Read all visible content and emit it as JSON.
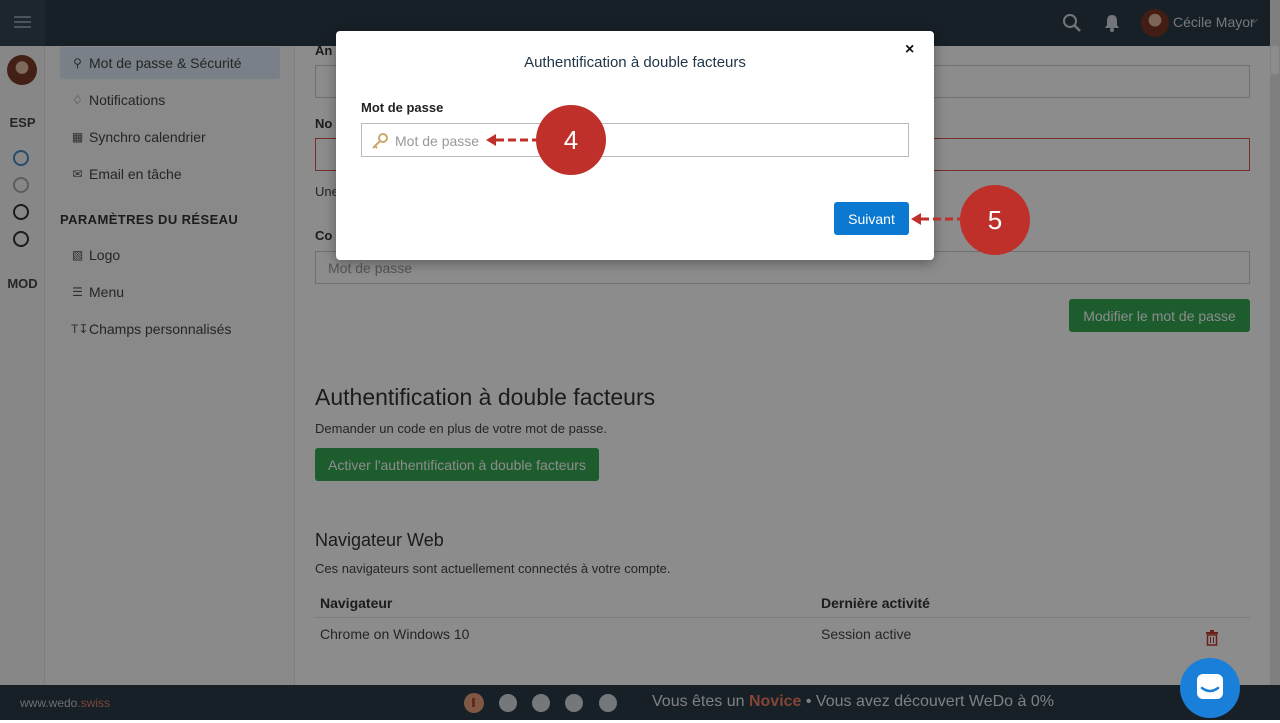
{
  "topbar": {
    "user_name": "Cécile Mayor",
    "icons": [
      "menu-icon",
      "search-icon",
      "bell-icon",
      "chevron-down-icon"
    ]
  },
  "rail": {
    "labels": [
      "ESP",
      "MOD"
    ]
  },
  "settings_nav": {
    "items": [
      {
        "label": "Mot de passe & Sécurité",
        "icon": "key-icon",
        "active": true
      },
      {
        "label": "Notifications",
        "icon": "bell-icon"
      },
      {
        "label": "Synchro calendrier",
        "icon": "calendar-icon"
      },
      {
        "label": "Email en tâche",
        "icon": "envelope-icon"
      }
    ],
    "section_title": "PARAMÈTRES DU RÉSEAU",
    "network_items": [
      {
        "label": "Logo",
        "icon": "building-icon"
      },
      {
        "label": "Menu",
        "icon": "bars-icon"
      },
      {
        "label": "Champs personnalisés",
        "icon": "text-icon"
      }
    ]
  },
  "main": {
    "fragments": {
      "old": "An",
      "new": "No",
      "hint": "Une",
      "confirm": "Co"
    },
    "password_placeholder": "Mot de passe",
    "change_password_button": "Modifier le mot de passe",
    "twofa_heading": "Authentification à double facteurs",
    "twofa_description": "Demander un code en plus de votre mot de passe.",
    "twofa_button": "Activer l'authentification à double facteurs",
    "browsers_heading": "Navigateur Web",
    "browsers_description": "Ces navigateurs sont actuellement connectés à votre compte.",
    "table": {
      "headers": [
        "Navigateur",
        "Dernière activité"
      ],
      "rows": [
        [
          "Chrome on Windows 10",
          "Session active"
        ]
      ]
    }
  },
  "footer": {
    "brand_prefix": "www.wedo",
    "brand_suffix": ".swiss",
    "msg_prefix": "Vous êtes un ",
    "level": "Novice",
    "msg_suffix": " • Vous avez découvert WeDo à 0%",
    "progress_percent": 0,
    "steps": 5,
    "current_step": 1
  },
  "modal": {
    "title": "Authentification à double facteurs",
    "close": "×",
    "password_label": "Mot de passe",
    "password_placeholder": "Mot de passe",
    "submit": "Suivant"
  },
  "annotations": [
    {
      "number": "4",
      "target": "password-input"
    },
    {
      "number": "5",
      "target": "suivant-button"
    }
  ],
  "colors": {
    "topbar": "#2a3a47",
    "primary": "#0b78d1",
    "success": "#34a853",
    "marker": "#c0302a",
    "level": "#f07e63"
  }
}
